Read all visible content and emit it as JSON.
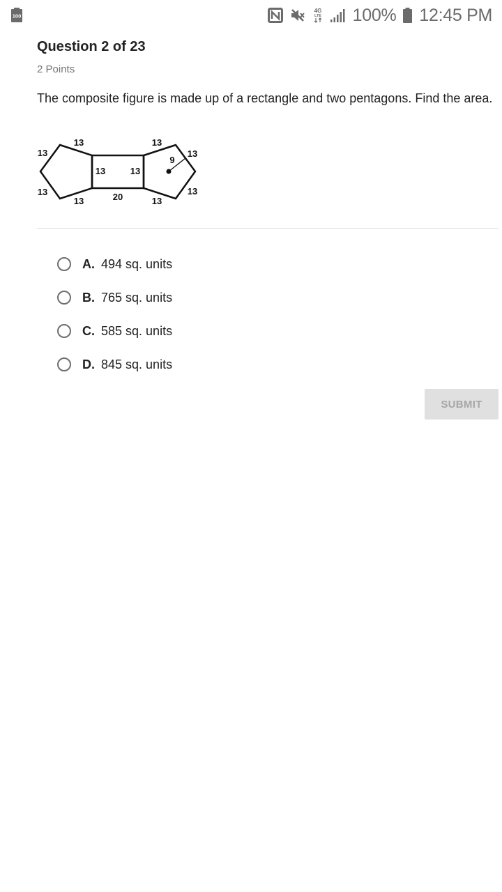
{
  "status_bar": {
    "battery_left_label": "100",
    "battery_percent": "100%",
    "time": "12:45 PM",
    "network_label": "4G",
    "lte_label": "LTE",
    "icons": [
      "battery-saver-icon",
      "nfc-icon",
      "mute-icon",
      "lte-data-icon",
      "signal-icon",
      "battery-icon"
    ]
  },
  "question": {
    "title": "Question 2 of 23",
    "points": "2 Points",
    "text": "The composite figure is made up of a rectangle and two pentagons. Find the area."
  },
  "figure": {
    "labels": {
      "left_top": "13",
      "left_upper": "13",
      "left_lower": "13",
      "left_bottom": "13",
      "rect_left": "13",
      "rect_right": "13",
      "rect_bottom": "20",
      "right_top": "13",
      "right_upper": "13",
      "right_lower": "13",
      "right_bottom": "13",
      "apothem": "9"
    }
  },
  "options": [
    {
      "letter": "A.",
      "text": "494 sq. units"
    },
    {
      "letter": "B.",
      "text": "765 sq. units"
    },
    {
      "letter": "C.",
      "text": "585 sq. units"
    },
    {
      "letter": "D.",
      "text": "845 sq. units"
    }
  ],
  "submit_label": "SUBMIT",
  "colors": {
    "submit_bg": "#e0e0e0",
    "submit_text": "#a6a6a6",
    "radio_border": "#6e6e6e",
    "status_text": "#6b6b6b"
  }
}
